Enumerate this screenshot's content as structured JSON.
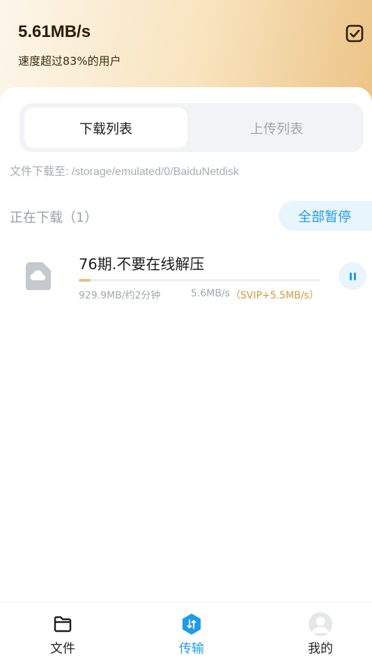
{
  "header": {
    "speed": "5.61MB/s",
    "speed_desc": "速度超过83%的用户"
  },
  "tabs": [
    {
      "label": "下载列表",
      "active": true
    },
    {
      "label": "上传列表",
      "active": false
    }
  ],
  "download_path": "文件下载至: /storage/emulated/0/BaiduNetdisk",
  "downloading": {
    "title": "正在下载（1）",
    "pause_all_label": "全部暂停"
  },
  "download_item": {
    "name": "76期.不要在线解压",
    "size_eta": "929.9MB/约2分钟",
    "rate": "5.6MB/s",
    "vip_boost": "（SVIP+5.5MB/s）",
    "progress": 0.05
  },
  "bottom_nav": [
    {
      "label": "文件",
      "icon": "folder-icon",
      "active": false
    },
    {
      "label": "传输",
      "icon": "transfer-icon",
      "active": true
    },
    {
      "label": "我的",
      "icon": "avatar-icon",
      "active": false
    }
  ],
  "colors": {
    "accent": "#1e9be9",
    "vip": "#d19a38",
    "header_gradient_end": "#ecc487"
  }
}
